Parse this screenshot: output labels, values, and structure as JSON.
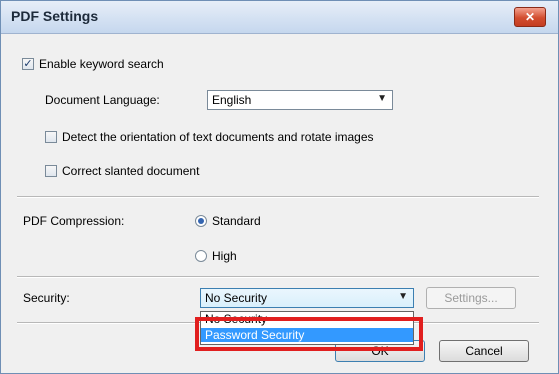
{
  "window": {
    "title": "PDF Settings",
    "close_glyph": "✕"
  },
  "keyword_search": {
    "label": "Enable keyword search",
    "checked": true
  },
  "document_language": {
    "label": "Document Language:",
    "value": "English"
  },
  "detect_orientation": {
    "label": "Detect the orientation of text documents and rotate images",
    "checked": false
  },
  "correct_slanted": {
    "label": "Correct slanted document",
    "checked": false
  },
  "compression": {
    "label": "PDF Compression:",
    "options": [
      {
        "label": "Standard",
        "selected": true
      },
      {
        "label": "High",
        "selected": false
      }
    ]
  },
  "security": {
    "label": "Security:",
    "value": "No Security",
    "settings_label": "Settings...",
    "dropdown_items": [
      "No Security",
      "Password Security"
    ],
    "highlighted_item": "Password Security"
  },
  "buttons": {
    "ok": "OK",
    "cancel": "Cancel"
  },
  "icons": {
    "checkmark": "checkmark-icon",
    "dropdown_caret": "chevron-down-icon",
    "close": "close-icon"
  },
  "colors": {
    "highlight": "#3399ff",
    "callout": "#e11f1f",
    "titlebar": "#c5d7ee"
  }
}
